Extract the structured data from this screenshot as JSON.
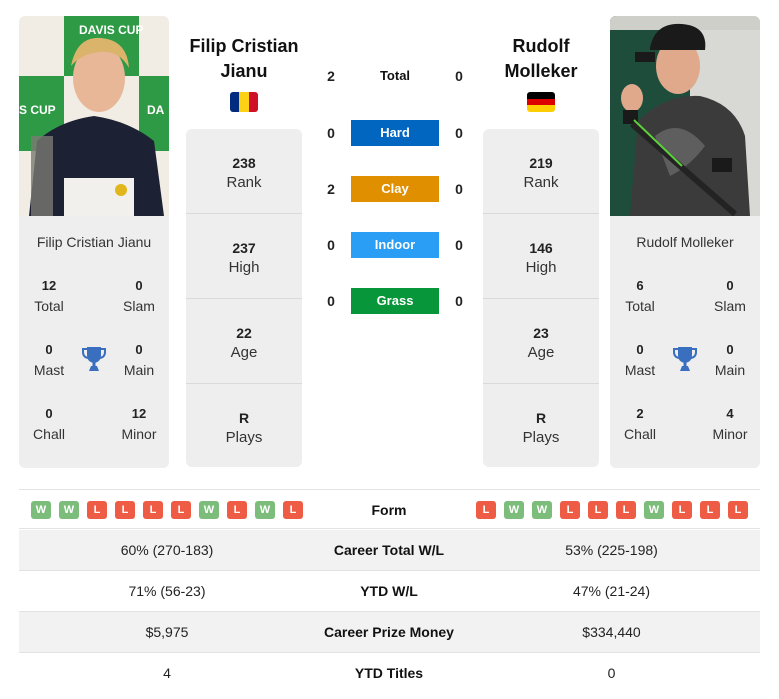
{
  "player1": {
    "name": "Filip Cristian Jianu",
    "name_line1": "Filip Cristian",
    "name_line2": "Jianu",
    "flag": "Romania",
    "flag_colors": [
      "#002B7F",
      "#FCD116",
      "#CE1126"
    ],
    "photo_alt": "player-photo-davis-cup-press-conference",
    "titles": {
      "total": "12",
      "total_label": "Total",
      "slam": "0",
      "slam_label": "Slam",
      "mast": "0",
      "mast_label": "Mast",
      "main": "0",
      "main_label": "Main",
      "chall": "0",
      "chall_label": "Chall",
      "minor": "12",
      "minor_label": "Minor"
    },
    "stats": [
      {
        "value": "238",
        "label": "Rank"
      },
      {
        "value": "237",
        "label": "High"
      },
      {
        "value": "22",
        "label": "Age"
      },
      {
        "value": "R",
        "label": "Plays"
      }
    ],
    "form": [
      "W",
      "W",
      "L",
      "L",
      "L",
      "L",
      "W",
      "L",
      "W",
      "L"
    ]
  },
  "player2": {
    "name": "Rudolf Molleker",
    "name_line1": "Rudolf",
    "name_line2": "Molleker",
    "flag": "Germany",
    "flag_colors": [
      "#000000",
      "#DD0000",
      "#FFCE00"
    ],
    "photo_alt": "player-photo-on-court",
    "titles": {
      "total": "6",
      "total_label": "Total",
      "slam": "0",
      "slam_label": "Slam",
      "mast": "0",
      "mast_label": "Mast",
      "main": "0",
      "main_label": "Main",
      "chall": "2",
      "chall_label": "Chall",
      "minor": "4",
      "minor_label": "Minor"
    },
    "stats": [
      {
        "value": "219",
        "label": "Rank"
      },
      {
        "value": "146",
        "label": "High"
      },
      {
        "value": "23",
        "label": "Age"
      },
      {
        "value": "R",
        "label": "Plays"
      }
    ],
    "form": [
      "L",
      "W",
      "W",
      "L",
      "L",
      "L",
      "W",
      "L",
      "L",
      "L"
    ]
  },
  "h2h": [
    {
      "label": "Total",
      "p1": "2",
      "p2": "0",
      "color": null
    },
    {
      "label": "Hard",
      "p1": "0",
      "p2": "0",
      "color": "#0066c0"
    },
    {
      "label": "Clay",
      "p1": "2",
      "p2": "0",
      "color": "#df8f00"
    },
    {
      "label": "Indoor",
      "p1": "0",
      "p2": "0",
      "color": "#2a9df4"
    },
    {
      "label": "Grass",
      "p1": "0",
      "p2": "0",
      "color": "#08963b"
    }
  ],
  "form_label": "Form",
  "comparison": [
    {
      "label": "Career Total W/L",
      "p1": "60% (270-183)",
      "p2": "53% (225-198)"
    },
    {
      "label": "YTD W/L",
      "p1": "71% (56-23)",
      "p2": "47% (21-24)"
    },
    {
      "label": "Career Prize Money",
      "p1": "$5,975",
      "p2": "$334,440"
    },
    {
      "label": "YTD Titles",
      "p1": "4",
      "p2": "0"
    }
  ],
  "colors": {
    "win": "#7cbd7c",
    "loss": "#ee5c45",
    "trophy": "#3a6fbf",
    "card_bg": "#eeeeee"
  }
}
